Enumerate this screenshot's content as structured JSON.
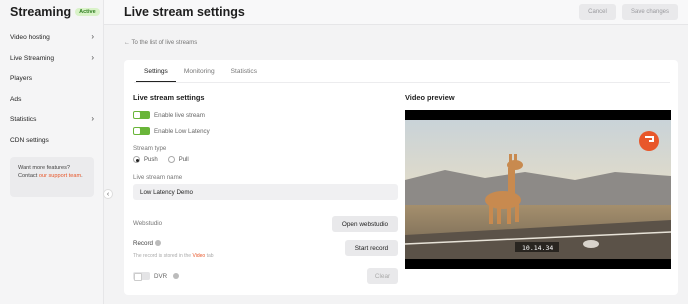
{
  "brand": {
    "name": "Streaming",
    "badge": "Active"
  },
  "sidebar": {
    "items": [
      {
        "label": "Video hosting",
        "chevron": true
      },
      {
        "label": "Live Streaming",
        "chevron": true
      },
      {
        "label": "Players",
        "chevron": false
      },
      {
        "label": "Ads",
        "chevron": false
      },
      {
        "label": "Statistics",
        "chevron": true
      },
      {
        "label": "CDN settings",
        "chevron": false
      }
    ],
    "promo": {
      "line1": "Want more features?",
      "line2": "Contact ",
      "link": "our support team",
      "end": "."
    },
    "collapse_icon": "‹"
  },
  "header": {
    "title": "Live stream settings",
    "cancel_label": "Cancel",
    "save_label": "Save changes"
  },
  "back_link": "← To the list of live streams",
  "tabs": [
    "Settings",
    "Monitoring",
    "Statistics"
  ],
  "settings": {
    "title": "Live stream settings",
    "enable_live": "Enable live stream",
    "enable_low_latency": "Enable Low Latency",
    "stream_type_label": "Stream type",
    "push_label": "Push",
    "pull_label": "Pull",
    "name_label": "Live stream name",
    "name_value": "Low Latency Demo",
    "webstudio_label": "Webstudio",
    "open_webstudio": "Open webstudio",
    "record_label": "Record",
    "record_note_pre": "The record is stored in the ",
    "record_note_link": "Video",
    "record_note_post": " tab",
    "start_record": "Start record",
    "dvr_label": "DVR",
    "clear_label": "Clear"
  },
  "preview": {
    "title": "Video preview",
    "timecode": "10.14.34"
  },
  "colors": {
    "accent": "#e8572a",
    "toggle_on": "#69b539",
    "badge_bg": "#d9f2c8"
  }
}
